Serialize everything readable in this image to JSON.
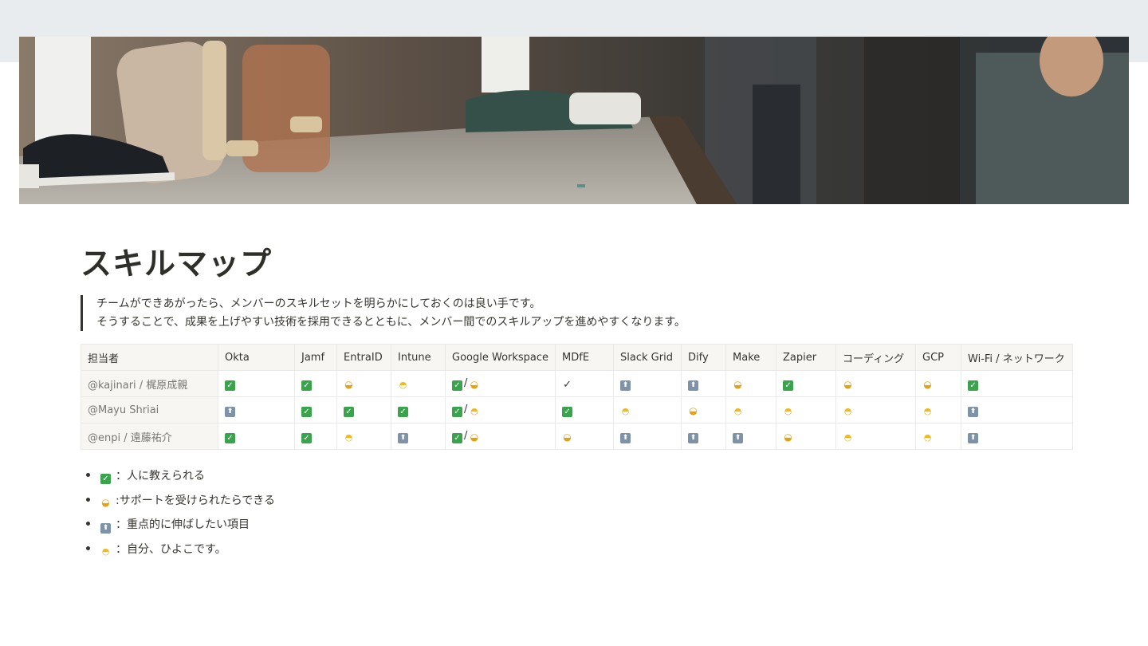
{
  "page": {
    "title": "スキルマップ",
    "description": [
      "チームができあがったら、メンバーのスキルセットを明らかにしておくのは良い手です。",
      "そうすることで、成果を上げやすい技術を採用できるとともに、メンバー間でのスキルアップを進めやすくなります。"
    ]
  },
  "icons": {
    "check": {
      "glyph": "✓",
      "name": "white-check-mark-icon",
      "color": "#3aa44c"
    },
    "handshake": {
      "glyph": "🤝",
      "name": "handshake-icon",
      "color": "#e0a318"
    },
    "up": {
      "glyph": "⬆",
      "name": "up-arrow-icon",
      "color": "#7f93a8"
    },
    "chick": {
      "glyph": "🐣",
      "name": "hatching-chick-icon",
      "color": "#f2b81e"
    },
    "tick": {
      "glyph": "✓",
      "name": "heavy-check-icon",
      "color": "#37352f"
    }
  },
  "table": {
    "columns": [
      "担当者",
      "Okta",
      "Jamf",
      "EntraID",
      "Intune",
      "Google Workspace",
      "MDfE",
      "Slack Grid",
      "Dify",
      "Make",
      "Zapier",
      "コーディング",
      "GCP",
      "Wi-Fi / ネットワーク"
    ],
    "rows": [
      {
        "member": "@kajinari / 梶原成親",
        "cells": [
          [
            "check"
          ],
          [
            "check"
          ],
          [
            "handshake"
          ],
          [
            "chick"
          ],
          [
            "check",
            "/",
            "handshake"
          ],
          [
            "tick"
          ],
          [
            "up"
          ],
          [
            "up"
          ],
          [
            "handshake"
          ],
          [
            "check"
          ],
          [
            "handshake"
          ],
          [
            "handshake"
          ],
          [
            "check"
          ]
        ]
      },
      {
        "member": "@Mayu Shriai",
        "cells": [
          [
            "up"
          ],
          [
            "check"
          ],
          [
            "check"
          ],
          [
            "check"
          ],
          [
            "check",
            "/",
            "chick"
          ],
          [
            "check"
          ],
          [
            "chick"
          ],
          [
            "handshake"
          ],
          [
            "chick"
          ],
          [
            "chick"
          ],
          [
            "chick"
          ],
          [
            "chick"
          ],
          [
            "up"
          ]
        ]
      },
      {
        "member": "@enpi / 遠藤祐介",
        "cells": [
          [
            "check"
          ],
          [
            "check"
          ],
          [
            "chick"
          ],
          [
            "up"
          ],
          [
            "check",
            "/",
            "handshake"
          ],
          [
            "handshake"
          ],
          [
            "up"
          ],
          [
            "up"
          ],
          [
            "up"
          ],
          [
            "handshake"
          ],
          [
            "chick"
          ],
          [
            "chick"
          ],
          [
            "up"
          ]
        ]
      }
    ]
  },
  "legend": [
    {
      "icon": "check",
      "text": "：人に教えられる"
    },
    {
      "icon": "handshake",
      "text": ":サポートを受けられたらできる"
    },
    {
      "icon": "up",
      "text": "：重点的に伸ばしたい項目"
    },
    {
      "icon": "chick",
      "text": "：自分、ひよこです。"
    }
  ]
}
